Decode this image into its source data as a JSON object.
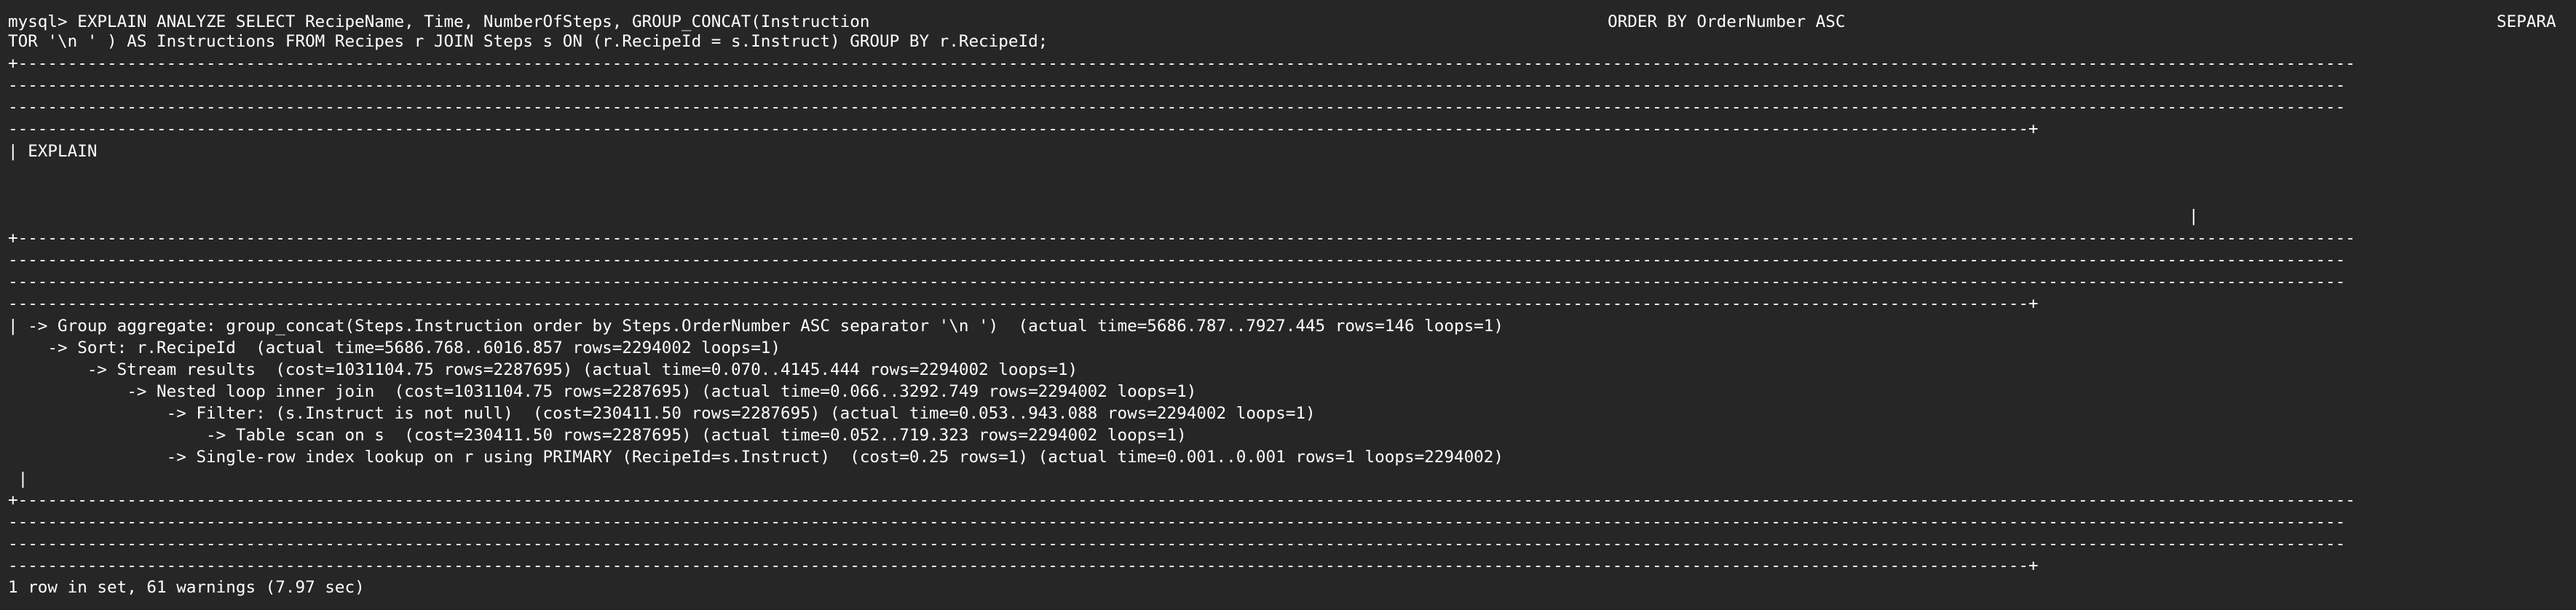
{
  "terminal": {
    "command_line1_part1": "mysql> EXPLAIN ANALYZE SELECT RecipeName, Time, NumberOfSteps, GROUP_CONCAT(Instruction",
    "command_line1_part2": "ORDER BY OrderNumber ASC",
    "command_line1_part3": "SEPARA",
    "command_line2": "TOR '\\n ' ) AS Instructions FROM Recipes r JOIN Steps s ON (r.RecipeId = s.Instruct) GROUP BY r.RecipeId;",
    "border_top_start": "+--------------------------------------------------------------------------------------------------------------------------------------------------------------------------------------------------------------------------------------------",
    "border_full": "--------------------------------------------------------------------------------------------------------------------------------------------------------------------------------------------------------------------------------------------",
    "border_end": "------------------------------------------------------------------------------------------------------------------------------------------------------------------------------------------------------------+",
    "header_cell": "| EXPLAIN",
    "header_right_pipe": "|",
    "plan_lines": [
      "| -> Group aggregate: group_concat(Steps.Instruction order by Steps.OrderNumber ASC separator '\\n ')  (actual time=5686.787..7927.445 rows=146 loops=1)",
      "    -> Sort: r.RecipeId  (actual time=5686.768..6016.857 rows=2294002 loops=1)",
      "        -> Stream results  (cost=1031104.75 rows=2287695) (actual time=0.070..4145.444 rows=2294002 loops=1)",
      "            -> Nested loop inner join  (cost=1031104.75 rows=2287695) (actual time=0.066..3292.749 rows=2294002 loops=1)",
      "                -> Filter: (s.Instruct is not null)  (cost=230411.50 rows=2287695) (actual time=0.053..943.088 rows=2294002 loops=1)",
      "                    -> Table scan on s  (cost=230411.50 rows=2287695) (actual time=0.052..719.323 rows=2294002 loops=1)",
      "                -> Single-row index lookup on r using PRIMARY (RecipeId=s.Instruct)  (cost=0.25 rows=1) (actual time=0.001..0.001 rows=1 loops=2294002)"
    ],
    "plan_end_pipe": " |",
    "result_summary": "1 row in set, 61 warnings (7.97 sec)"
  }
}
